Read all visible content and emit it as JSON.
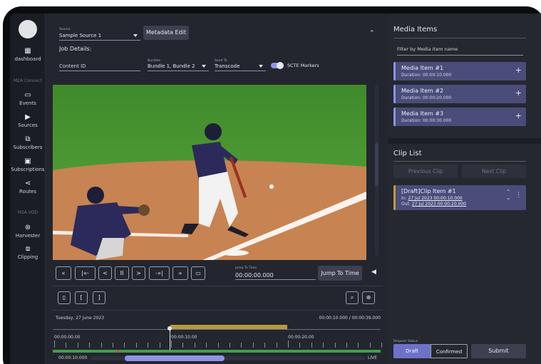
{
  "nav": {
    "items": [
      {
        "label": "dashboard",
        "icon": "dashboard-icon"
      },
      {
        "label": "Events",
        "icon": "events-icon"
      },
      {
        "label": "Sources",
        "icon": "sources-icon"
      },
      {
        "label": "Subscribers",
        "icon": "subscribers-icon"
      },
      {
        "label": "Subscriptions",
        "icon": "subscriptions-icon"
      },
      {
        "label": "Routes",
        "icon": "routes-icon"
      },
      {
        "label": "Harvester",
        "icon": "harvester-icon"
      },
      {
        "label": "Clipping",
        "icon": "clipping-icon"
      }
    ],
    "sections": {
      "m2a_connect": "M2A Connect",
      "m2a_vod": "M2A VOD"
    }
  },
  "editor": {
    "source_label": "Source",
    "source_value": "Sample Source 1",
    "metadata_button": "Metadata Edit",
    "job_details": "Job Details:",
    "content_id_placeholder": "Content ID",
    "bundles_label": "Bundles",
    "bundles_value": "Bundle 1, Bundle 2",
    "send_to_label": "Send To",
    "send_to_value": "Transcode",
    "scte_label": "SCTE Markers",
    "scte_enabled": true
  },
  "player": {
    "controls": [
      "«",
      "|«-",
      "<",
      "II",
      ">",
      "-»|",
      "»",
      "▭"
    ],
    "jump_label": "Jump To Time",
    "jump_value": "00:00:00.000",
    "jump_button": "Jump To Time"
  },
  "timeline": {
    "tools": [
      "▯",
      "[",
      "]"
    ],
    "date": "Tuesday, 27 June 2023",
    "time_readout": "00:00:10.000 / 00:00:39.000",
    "markers": [
      "00:00:00.00",
      "00:00:10.00",
      "00:00:20.00"
    ],
    "bottom_time": "00:00:10.000",
    "live_label": "LIVE"
  },
  "media": {
    "title": "Media Items",
    "filter_placeholder": "Filter by Media Item name",
    "items": [
      {
        "name": "Media Item #1",
        "duration": "Duration: 00:00:10.000"
      },
      {
        "name": "Media Item #2",
        "duration": "Duration: 00:00:20.000"
      },
      {
        "name": "Media Item #3",
        "duration": "Duration: 00:00:30.000"
      }
    ]
  },
  "clips": {
    "title": "Clip List",
    "previous": "Previous Clip",
    "next": "Next Clip",
    "item": {
      "name": "[Draft]Clip Item #1",
      "in_label": "In:",
      "in_value": "27 Jul 2023 00:00:10.000",
      "out_label": "Out:",
      "out_value": "27 Jul 2023 00:00:20.000"
    },
    "request_status_label": "Request Status",
    "status_options": [
      "Draft",
      "Confirmed"
    ],
    "selected_status": "Draft",
    "submit": "Submit"
  },
  "colors": {
    "accent": "#8e93e8",
    "clip_accent": "#c29a3d",
    "timeline_green": "#3fa146"
  }
}
